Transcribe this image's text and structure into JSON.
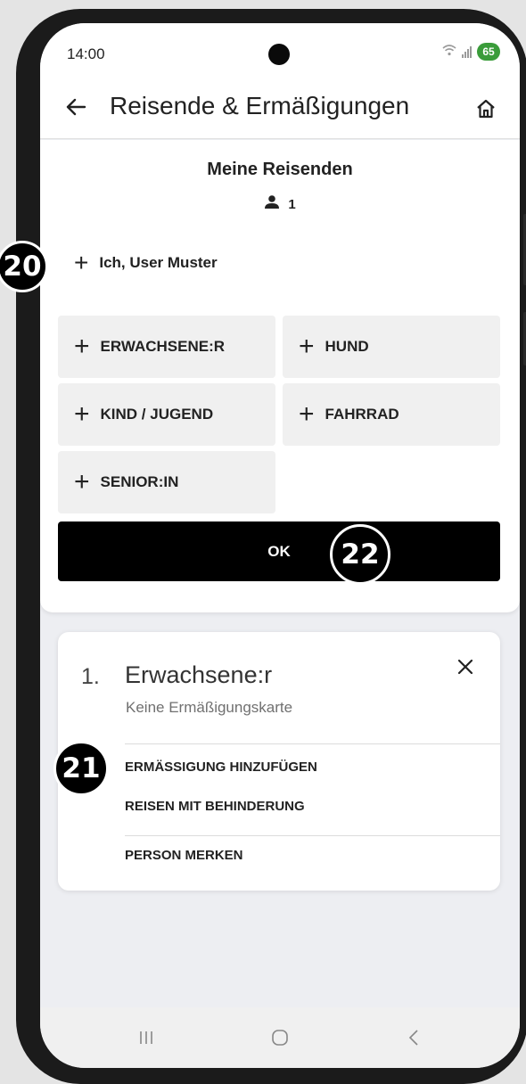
{
  "status_bar": {
    "time": "14:00",
    "battery": "65",
    "icons": [
      "wifi-icon",
      "signal-icon",
      "battery-icon"
    ]
  },
  "app_bar": {
    "title": "Reisende & Ermäßigungen",
    "back_icon": "back-arrow-icon",
    "home_icon": "home-icon"
  },
  "travellers": {
    "title": "Meine Reisenden",
    "count": "1",
    "count_icon": "person-icon",
    "me_label": "Ich, User Muster",
    "tiles": [
      {
        "label": "ERWACHSENE:R"
      },
      {
        "label": "HUND"
      },
      {
        "label": "KIND / JUGEND"
      },
      {
        "label": "FAHRRAD"
      },
      {
        "label": "SENIOR:IN"
      }
    ],
    "ok_label": "OK"
  },
  "traveller_card": {
    "index": "1.",
    "name": "Erwachsene:r",
    "subtitle": "Keine Ermäßigungskarte",
    "actions": [
      {
        "label": "ERMÄSSIGUNG HINZUFÜGEN"
      },
      {
        "label": "REISEN MIT BEHINDERUNG"
      },
      {
        "label": "PERSON MERKEN"
      }
    ]
  },
  "annotations": [
    {
      "label": "20"
    },
    {
      "label": "21"
    },
    {
      "label": "22"
    }
  ],
  "colors": {
    "primary_button": "#000000",
    "tile_background": "#f0f0f0",
    "battery": "#3a9c3a",
    "page_background": "#edeef2"
  }
}
